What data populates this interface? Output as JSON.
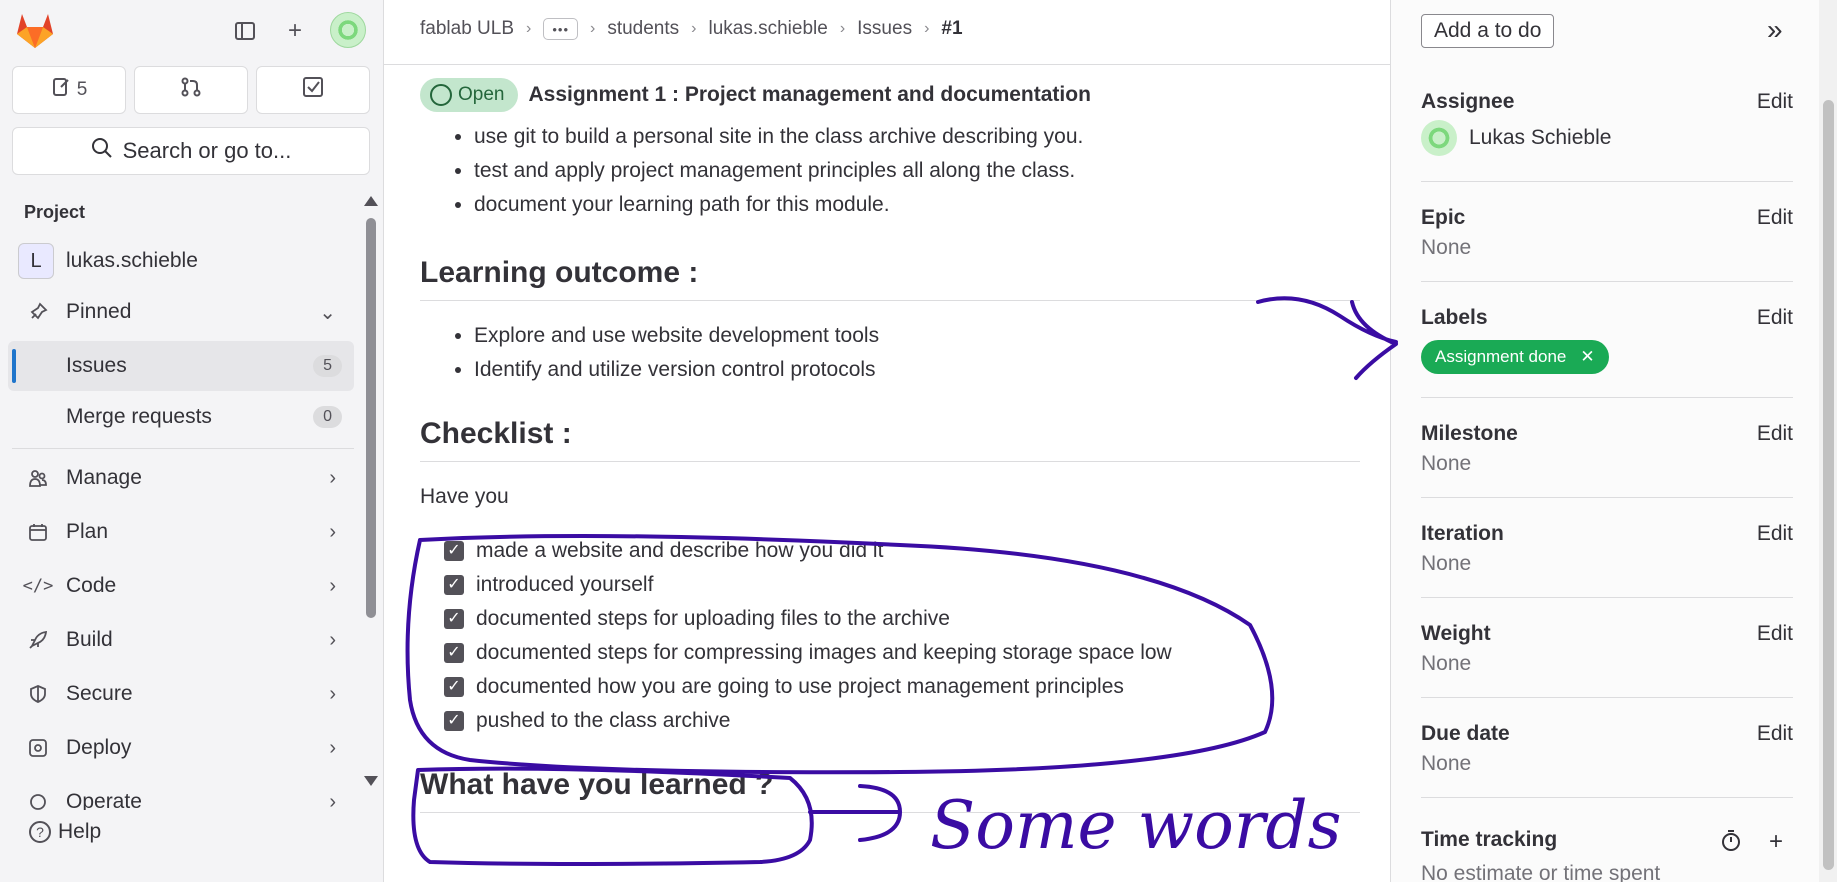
{
  "sidebar": {
    "counters": {
      "issues": "5"
    },
    "search": "Search or go to...",
    "section": "Project",
    "project": {
      "initial": "L",
      "name": "lukas.schieble"
    },
    "pinned": "Pinned",
    "issues": {
      "label": "Issues",
      "count": "5"
    },
    "merge_requests": {
      "label": "Merge requests",
      "count": "0"
    },
    "nav": [
      "Manage",
      "Plan",
      "Code",
      "Build",
      "Secure",
      "Deploy",
      "Operate"
    ],
    "help": "Help"
  },
  "breadcrumb": [
    "fablab ULB",
    "students",
    "lukas.schieble",
    "Issues",
    "#1"
  ],
  "issue": {
    "status": "Open",
    "title": "Assignment 1 : Project management and documentation",
    "goals": [
      "use git to build a personal site in the class archive describing you.",
      "test and apply project management principles all along the class.",
      "document your learning path for this module."
    ],
    "h_outcome": "Learning outcome :",
    "outcomes": [
      "Explore and use website development tools",
      "Identify and utilize version control protocols"
    ],
    "h_checklist": "Checklist :",
    "have_you": "Have you",
    "checklist": [
      "made a website and describe how you did it",
      "introduced yourself",
      "documented steps for uploading files to the archive",
      "documented steps for compressing images and keeping storage space low",
      "documented how you are going to use project management principles",
      "pushed to the class archive"
    ],
    "h_learned": "What have you learned ?"
  },
  "panel": {
    "todo": "Add a to do",
    "edit": "Edit",
    "none": "None",
    "assignee": {
      "title": "Assignee",
      "name": "Lukas Schieble"
    },
    "epic": "Epic",
    "labels": {
      "title": "Labels",
      "chip": "Assignment done",
      "color": "#1aaa55"
    },
    "milestone": "Milestone",
    "iteration": "Iteration",
    "weight": "Weight",
    "due": "Due date",
    "time_tracking": "Time tracking",
    "time_text": "No estimate or time spent"
  },
  "annotation": {
    "handwriting": "Some words",
    "ink_color": "#3a0ca3"
  }
}
